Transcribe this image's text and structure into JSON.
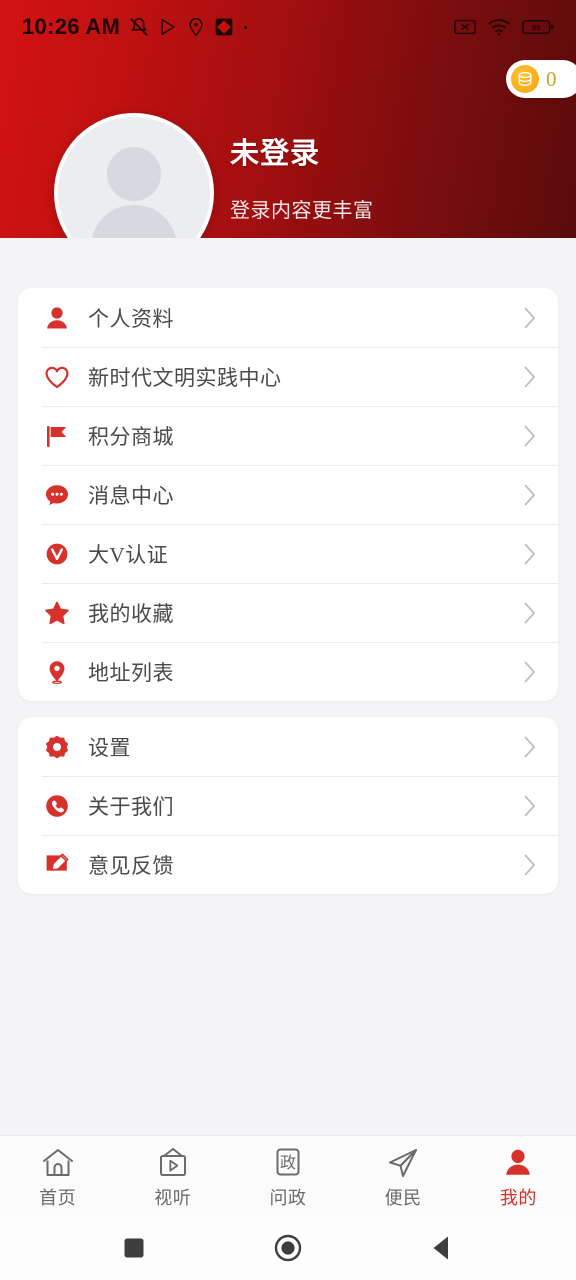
{
  "statusbar": {
    "time": "10:26 AM",
    "left_icons": [
      "mute-bell-icon",
      "play-store-icon",
      "location-pin-icon",
      "app-diamond-icon"
    ],
    "right_icons": [
      "no-sim-icon",
      "wifi-icon",
      "battery-icon"
    ],
    "battery_level": "58"
  },
  "header": {
    "coin_badge": {
      "icon": "coin-icon",
      "count": "0"
    },
    "avatar": "default-user-avatar",
    "name": "未登录",
    "subtitle": "登录内容更丰富",
    "gradient_from": "#d21413",
    "gradient_to": "#5a0c0c"
  },
  "accent_color": "#d6322b",
  "groups": [
    {
      "items": [
        {
          "icon": "user-icon",
          "label": "个人资料"
        },
        {
          "icon": "heart-icon",
          "label": "新时代文明实践中心"
        },
        {
          "icon": "flag-icon",
          "label": "积分商城"
        },
        {
          "icon": "chat-bubble-icon",
          "label": "消息中心"
        },
        {
          "icon": "verified-v-icon",
          "label": "大V认证"
        },
        {
          "icon": "star-icon",
          "label": "我的收藏"
        },
        {
          "icon": "location-pin-icon",
          "label": "地址列表"
        }
      ]
    },
    {
      "items": [
        {
          "icon": "gear-icon",
          "label": "设置"
        },
        {
          "icon": "phone-icon",
          "label": "关于我们"
        },
        {
          "icon": "pencil-icon",
          "label": "意见反馈"
        }
      ]
    }
  ],
  "tabbar": {
    "tabs": [
      {
        "icon": "home-icon",
        "label": "首页",
        "active": false
      },
      {
        "icon": "tv-play-icon",
        "label": "视听",
        "active": false
      },
      {
        "icon": "zheng-box-icon",
        "label": "问政",
        "active": false
      },
      {
        "icon": "paper-plane-icon",
        "label": "便民",
        "active": false
      },
      {
        "icon": "person-icon",
        "label": "我的",
        "active": true
      }
    ]
  },
  "system_nav": {
    "buttons": [
      {
        "icon": "recents-square-icon",
        "label": "Recents"
      },
      {
        "icon": "home-circle-icon",
        "label": "Home"
      },
      {
        "icon": "back-triangle-icon",
        "label": "Back"
      }
    ]
  }
}
